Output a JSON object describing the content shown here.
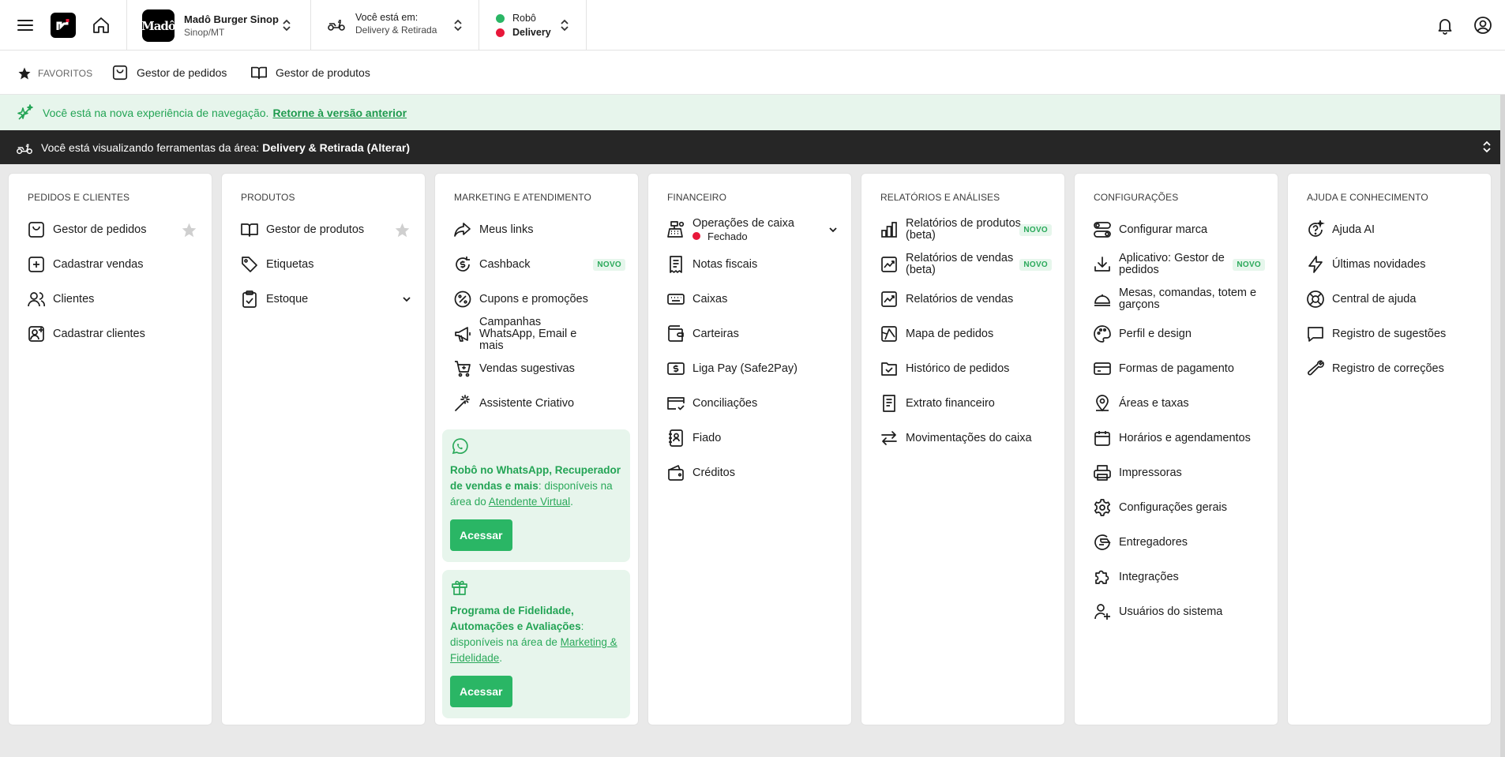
{
  "topbar": {
    "store_logo_text": "Madô",
    "store_name": "Madô Burger Sinop",
    "store_city": "Sinop/MT",
    "area_label": "Você está em:",
    "area_value": "Delivery & Retirada",
    "status_robo": "Robô",
    "status_delivery": "Delivery",
    "status_colors": {
      "robo": "#2ab665",
      "delivery": "#e8173a"
    }
  },
  "favorites": {
    "title": "FAVORITOS",
    "links": [
      {
        "label": "Gestor de pedidos",
        "icon": "bag-icon"
      },
      {
        "label": "Gestor de produtos",
        "icon": "book-open-icon"
      }
    ]
  },
  "nav_banner": {
    "text": "Você está na nova experiência de navegação.",
    "link": "Retorne à versão anterior"
  },
  "area_banner": {
    "text": "Você está visualizando ferramentas da área:",
    "area": "Delivery & Retirada (Alterar)"
  },
  "columns": [
    {
      "title": "PEDIDOS E CLIENTES",
      "items": [
        {
          "label": "Gestor de pedidos",
          "icon": "bag-icon"
        },
        {
          "label": "Cadastrar vendas",
          "icon": "plus-square-icon"
        },
        {
          "label": "Clientes",
          "icon": "users-icon"
        },
        {
          "label": "Cadastrar clientes",
          "icon": "user-add-icon"
        }
      ]
    },
    {
      "title": "PRODUTOS",
      "items": [
        {
          "label": "Gestor de produtos",
          "icon": "book-open-icon"
        },
        {
          "label": "Etiquetas",
          "icon": "tag-icon"
        },
        {
          "label": "Estoque",
          "icon": "clipboard-check-icon"
        }
      ]
    },
    {
      "title": "MARKETING E ATENDIMENTO",
      "items": [
        {
          "label": "Meus links",
          "icon": "share-icon"
        },
        {
          "label": "Cashback",
          "icon": "cashback-icon",
          "badge": "NOVO"
        },
        {
          "label": "Cupons e promoções",
          "icon": "percent-icon"
        },
        {
          "label": "Campanhas WhatsApp, Email e mais",
          "icon": "megaphone-icon"
        },
        {
          "label": "Vendas sugestivas",
          "icon": "cart-plus-icon"
        },
        {
          "label": "Assistente Criativo",
          "icon": "magic-wand-icon"
        }
      ],
      "promos": [
        {
          "icon": "whatsapp-icon",
          "bold": "Robô no WhatsApp, Recuperador de vendas e mais",
          "text": ": disponíveis na área do ",
          "link": "Atendente Virtual",
          "end": ".",
          "button": "Acessar"
        },
        {
          "icon": "gift-icon",
          "bold": "Programa de Fidelidade, Automações e Avaliações",
          "text": ": disponíveis na área de ",
          "link": "Marketing & Fidelidade",
          "end": ".",
          "button": "Acessar"
        }
      ]
    },
    {
      "title": "FINANCEIRO",
      "items": [
        {
          "label": "Operações de caixa",
          "icon": "cash-register-icon",
          "status": "Fechado"
        },
        {
          "label": "Notas fiscais",
          "icon": "receipt-icon"
        },
        {
          "label": "Caixas",
          "icon": "keyboard-icon"
        },
        {
          "label": "Carteiras",
          "icon": "wallet-icon"
        },
        {
          "label": "Liga Pay (Safe2Pay)",
          "icon": "money-icon"
        },
        {
          "label": "Conciliações",
          "icon": "credit-card-check-icon"
        },
        {
          "label": "Fiado",
          "icon": "ledger-icon"
        },
        {
          "label": "Créditos",
          "icon": "wallet-coin-icon"
        }
      ]
    },
    {
      "title": "RELATÓRIOS E ANÁLISES",
      "items": [
        {
          "label": "Relatórios de produtos (beta)",
          "icon": "bar-chart-icon",
          "badge": "NOVO"
        },
        {
          "label": "Relatórios de vendas (beta)",
          "icon": "line-chart-icon",
          "badge": "NOVO"
        },
        {
          "label": "Relatórios de vendas",
          "icon": "line-chart-icon"
        },
        {
          "label": "Mapa de pedidos",
          "icon": "map-icon"
        },
        {
          "label": "Histórico de pedidos",
          "icon": "folder-check-icon"
        },
        {
          "label": "Extrato financeiro",
          "icon": "document-icon"
        },
        {
          "label": "Movimentações do caixa",
          "icon": "transfer-icon"
        }
      ]
    },
    {
      "title": "CONFIGURAÇÕES",
      "items": [
        {
          "label": "Configurar marca",
          "icon": "toggles-icon"
        },
        {
          "label": "Aplicativo: Gestor de pedidos",
          "icon": "download-icon",
          "badge": "NOVO"
        },
        {
          "label": "Mesas, comandas, totem e garçons",
          "icon": "cloche-icon"
        },
        {
          "label": "Perfil e design",
          "icon": "palette-icon"
        },
        {
          "label": "Formas de pagamento",
          "icon": "credit-card-icon"
        },
        {
          "label": "Áreas e taxas",
          "icon": "map-pin-icon"
        },
        {
          "label": "Horários e agendamentos",
          "icon": "calendar-icon"
        },
        {
          "label": "Impressoras",
          "icon": "printer-icon"
        },
        {
          "label": "Configurações gerais",
          "icon": "gear-icon"
        },
        {
          "label": "Entregadores",
          "icon": "delivery-icon"
        },
        {
          "label": "Integrações",
          "icon": "puzzle-icon"
        },
        {
          "label": "Usuários do sistema",
          "icon": "user-plus-icon"
        }
      ]
    },
    {
      "title": "AJUDA E CONHECIMENTO",
      "items": [
        {
          "label": "Ajuda AI",
          "icon": "ai-help-icon"
        },
        {
          "label": "Últimas novidades",
          "icon": "lightning-icon"
        },
        {
          "label": "Central de ajuda",
          "icon": "lifebuoy-icon"
        },
        {
          "label": "Registro de sugestões",
          "icon": "chat-icon"
        },
        {
          "label": "Registro de correções",
          "icon": "wrench-icon"
        }
      ]
    }
  ]
}
